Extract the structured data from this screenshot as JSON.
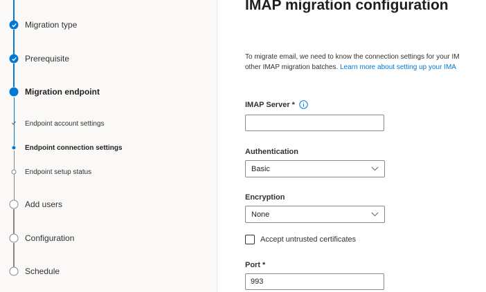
{
  "stepper": {
    "steps": [
      {
        "label": "Migration type",
        "state": "completed"
      },
      {
        "label": "Prerequisite",
        "state": "completed"
      },
      {
        "label": "Migration endpoint",
        "state": "current"
      },
      {
        "label": "Endpoint account settings",
        "state": "completed"
      },
      {
        "label": "Endpoint connection settings",
        "state": "current"
      },
      {
        "label": "Endpoint setup status",
        "state": "pending"
      },
      {
        "label": "Add users",
        "state": "pending"
      },
      {
        "label": "Configuration",
        "state": "pending"
      },
      {
        "label": "Schedule",
        "state": "pending"
      }
    ]
  },
  "main": {
    "title": "IMAP migration configuration",
    "description_line1": "To migrate email, we need to know the connection settings for your IM",
    "description_line2_prefix": "other IMAP migration batches.",
    "learn_more_link": "Learn more about setting up your IMA",
    "imap_server": {
      "label": "IMAP Server",
      "required_mark": "*",
      "value": "",
      "placeholder": ""
    },
    "authentication": {
      "label": "Authentication",
      "value": "Basic"
    },
    "encryption": {
      "label": "Encryption",
      "value": "None"
    },
    "accept_untrusted": {
      "label": "Accept untrusted certificates",
      "checked": false
    },
    "port": {
      "label": "Port",
      "required_mark": "*",
      "value": "993"
    }
  },
  "colors": {
    "accent": "#0078d4",
    "pending": "#8a8886"
  }
}
